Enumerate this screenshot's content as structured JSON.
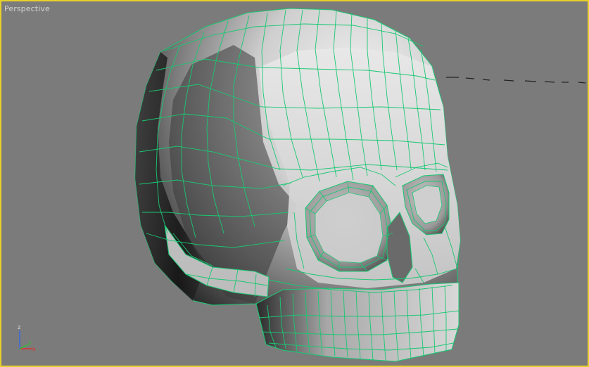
{
  "viewport": {
    "label": "Perspective",
    "border_color": "#e8d22a",
    "background_color": "#7b7b7b"
  },
  "mesh": {
    "object": "skull-icon",
    "wire_color": "#19c873",
    "shade_light": "#f2f2f2",
    "shade_dark": "#1e1e1e"
  },
  "axis": {
    "z_label": "z",
    "x_label": "x",
    "y_label": "y",
    "x_color": "#e03030",
    "y_color": "#30c030",
    "z_color": "#3a6ae0"
  }
}
